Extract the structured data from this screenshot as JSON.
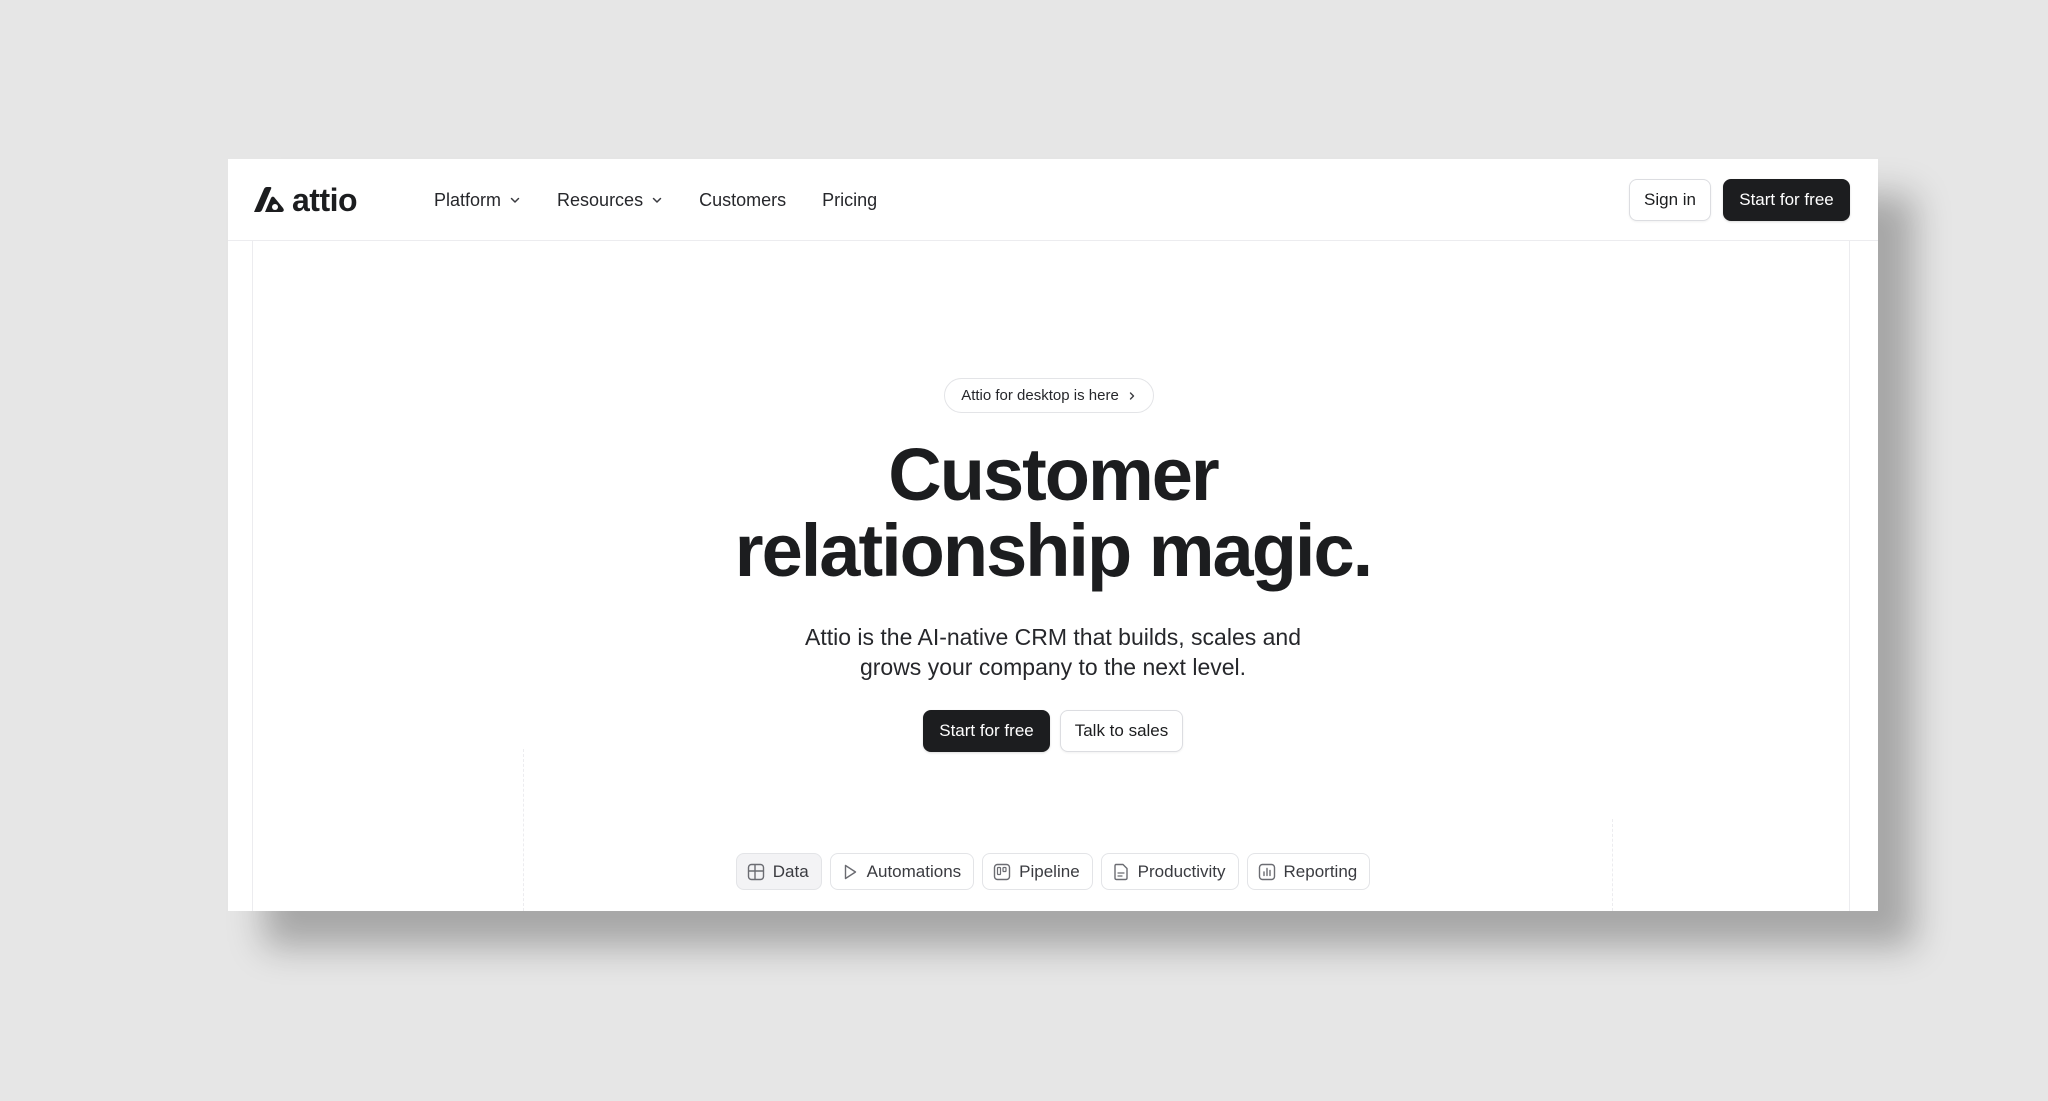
{
  "brand": {
    "name": "attio"
  },
  "nav": {
    "items": [
      {
        "label": "Platform",
        "has_dropdown": true
      },
      {
        "label": "Resources",
        "has_dropdown": true
      },
      {
        "label": "Customers",
        "has_dropdown": false
      },
      {
        "label": "Pricing",
        "has_dropdown": false
      }
    ]
  },
  "header": {
    "sign_in_label": "Sign in",
    "start_label": "Start for free"
  },
  "hero": {
    "badge_label": "Attio for desktop is here",
    "title_line1": "Customer",
    "title_line2": "relationship magic.",
    "subtitle_line1": "Attio is the AI-native CRM that builds, scales and",
    "subtitle_line2": "grows your company to the next level.",
    "primary_cta": "Start for free",
    "secondary_cta": "Talk to sales"
  },
  "tabs": [
    {
      "label": "Data",
      "icon": "data-grid-icon",
      "active": true
    },
    {
      "label": "Automations",
      "icon": "play-icon",
      "active": false
    },
    {
      "label": "Pipeline",
      "icon": "kanban-icon",
      "active": false
    },
    {
      "label": "Productivity",
      "icon": "document-icon",
      "active": false
    },
    {
      "label": "Reporting",
      "icon": "bar-chart-icon",
      "active": false
    }
  ],
  "colors": {
    "background": "#e6e6e6",
    "surface": "#ffffff",
    "text": "#1c1d1f",
    "primary_button": "#1c1d1f",
    "border": "#e3e4e7"
  }
}
